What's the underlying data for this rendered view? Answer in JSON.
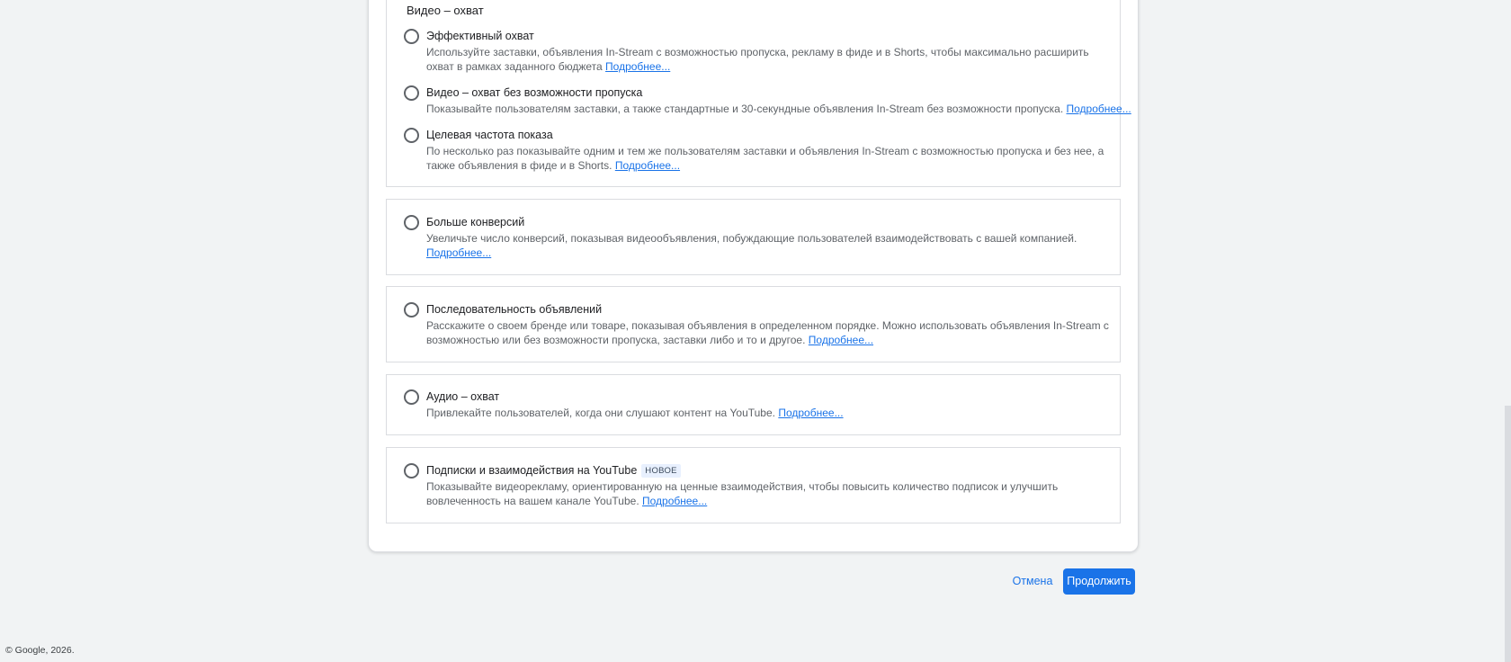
{
  "section": {
    "title": "Видео – охват"
  },
  "options": [
    {
      "title": "Эффективный охват",
      "desc": "Используйте заставки, объявления In-Stream с возможностью пропуска, рекламу в фиде и в Shorts, чтобы максимально расширить охват в рамках заданного бюджета",
      "more": "Подробнее..."
    },
    {
      "title": "Видео – охват без возможности пропуска",
      "desc": "Показывайте пользователям заставки, а также стандартные и 30-секундные объявления In-Stream без возможности пропуска.",
      "more": "Подробнее..."
    },
    {
      "title": "Целевая частота показа",
      "desc": "По несколько раз показывайте одним и тем же пользователям заставки и объявления In-Stream с возможностью пропуска и без нее, а также объявления в фиде и в Shorts.",
      "more": "Подробнее..."
    },
    {
      "title": "Больше конверсий",
      "desc": "Увеличьте число конверсий, показывая видеообъявления, побуждающие пользователей взаимодействовать с вашей компанией.",
      "more": "Подробнее..."
    },
    {
      "title": "Последовательность объявлений",
      "desc": "Расскажите о своем бренде или товаре, показывая объявления в определенном порядке. Можно использовать объявления In-Stream с возможностью или без возможности пропуска, заставки либо и то и другое.",
      "more": "Подробнее..."
    },
    {
      "title": "Аудио – охват",
      "desc": "Привлекайте пользователей, когда они слушают контент на YouTube.",
      "more": "Подробнее..."
    },
    {
      "title": "Подписки и взаимодействия на YouTube",
      "badge": "НОВОЕ",
      "desc": "Показывайте видеорекламу, ориентированную на ценные взаимодействия, чтобы повысить количество подписок и улучшить вовлеченность на вашем канале YouTube.",
      "more": "Подробнее..."
    }
  ],
  "actions": {
    "cancel": "Отмена",
    "continue": "Продолжить"
  },
  "footer": {
    "copyright": "© Google, 2026."
  },
  "colors": {
    "accent": "#1a73e8",
    "background": "#f1f3f4"
  }
}
